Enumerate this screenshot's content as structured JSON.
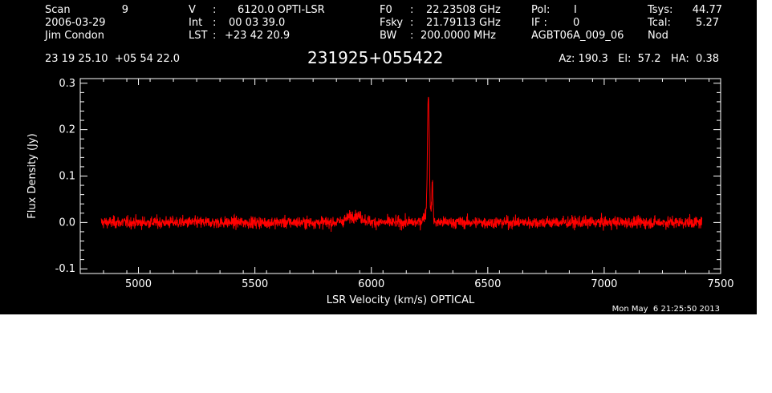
{
  "header": {
    "col1": [
      {
        "label": "Scan",
        "value": "9"
      },
      {
        "label": "",
        "value": "2006-03-29"
      },
      {
        "label": "",
        "value": "Jim Condon"
      }
    ],
    "col2": [
      {
        "label": "V",
        "sep": ":",
        "value": "6120.0 OPTI-LSR"
      },
      {
        "label": "Int",
        "sep": ":",
        "value": "00 03 39.0"
      },
      {
        "label": "LST",
        "sep": ":",
        "value": "+23 42 20.9"
      }
    ],
    "col3": [
      {
        "label": "F0",
        "sep": ":",
        "value": "22.23508 GHz"
      },
      {
        "label": "Fsky",
        "sep": ":",
        "value": "21.79113 GHz"
      },
      {
        "label": "BW",
        "sep": ":",
        "value": "200.0000 MHz"
      }
    ],
    "col4": [
      {
        "label": "Pol:",
        "value": "I"
      },
      {
        "label": "IF :",
        "value": "0"
      },
      {
        "label": "",
        "value": "AGBT06A_009_06"
      }
    ],
    "col5": [
      {
        "label": "Tsys:",
        "value": "44.77"
      },
      {
        "label": "Tcal:",
        "value": "5.27"
      },
      {
        "label": "Nod",
        "value": ""
      }
    ],
    "coords": "23 19 25.10  +05 54 22.0",
    "source": "231925+055422",
    "pointing": "Az: 190.3   El:  57.2   HA:  0.38",
    "timestamp": "Mon May  6 21:25:50 2013"
  },
  "colors": {
    "background": "#000000",
    "axes": "#ffffff",
    "series": "#ff0000"
  },
  "chart_data": {
    "type": "line",
    "title": "231925+055422",
    "xlabel": "LSR Velocity (km/s) OPTICAL",
    "ylabel": "Flux Density (Jy)",
    "xlim": [
      4750,
      7500
    ],
    "ylim": [
      -0.11,
      0.31
    ],
    "xticks": [
      5000,
      5500,
      6000,
      6500,
      7000,
      7500
    ],
    "xtick_labels": [
      "5000",
      "5500",
      "6000",
      "6500",
      "7000",
      "7500"
    ],
    "yticks": [
      -0.1,
      0.0,
      0.1,
      0.2,
      0.3
    ],
    "ytick_labels": [
      "-0.1",
      "0.0",
      "0.1",
      "0.2",
      "0.3"
    ],
    "grid": false,
    "series": [
      {
        "values_description": "noisy spectrum ~±0.02 Jy; broad bump ~0.015 Jy near 5930 km/s; narrow line peaking ~0.26 Jy at 6245 km/s",
        "x_range": [
          4840,
          7420
        ],
        "peak": {
          "x": 6245,
          "y": 0.26
        },
        "secondary_peak": {
          "x": 6262,
          "y": 0.075
        },
        "bump": {
          "x": 5930,
          "y": 0.015
        },
        "noise_rms": 0.009
      }
    ]
  }
}
